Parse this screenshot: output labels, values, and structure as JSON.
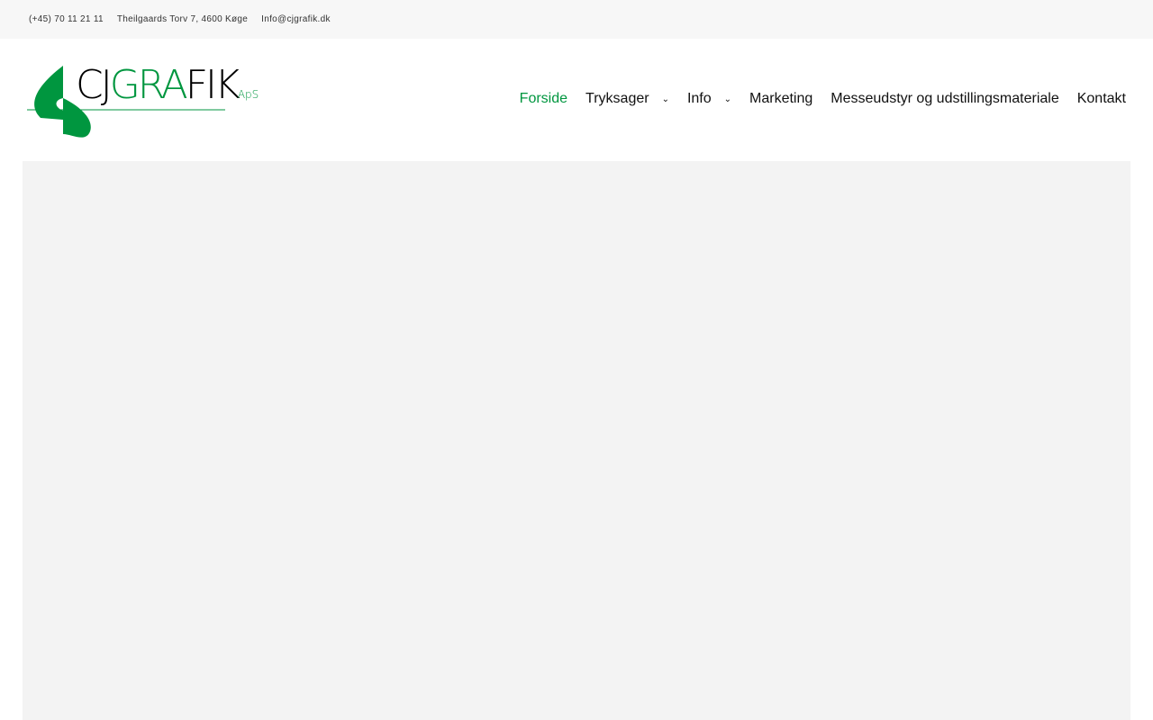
{
  "topbar": {
    "phone": "(+45) 70 11 21 11",
    "address": "Theilgaards Torv 7, 4600 Køge",
    "email": "Info@cjgrafik.dk"
  },
  "logo": {
    "text_dark1": "CJ",
    "text_green": "GRA",
    "text_dark2": "FIK",
    "suffix": "ApS"
  },
  "nav": [
    {
      "label": "Forside"
    },
    {
      "label": "Tryksager"
    },
    {
      "label": "Info"
    },
    {
      "label": "Marketing"
    },
    {
      "label": "Messeudstyr og udstillingsmateriale"
    },
    {
      "label": "Kontakt"
    }
  ],
  "colors": {
    "accent": "#00963f"
  }
}
